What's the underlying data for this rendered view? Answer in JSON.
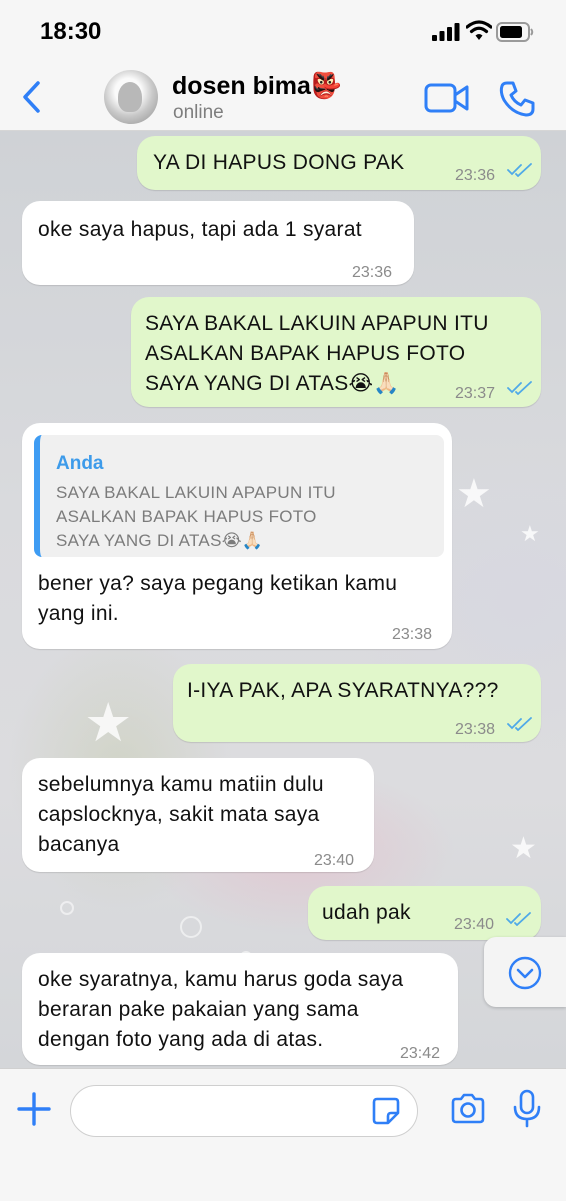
{
  "status_bar": {
    "time": "18:30"
  },
  "header": {
    "contact_name": "dosen bima👺",
    "status": "online"
  },
  "messages": [
    {
      "dir": "out",
      "text": "YA DI HAPUS DONG PAK",
      "time": "23:36"
    },
    {
      "dir": "in",
      "text": "oke saya hapus, tapi ada 1 syarat",
      "time": "23:36"
    },
    {
      "dir": "out",
      "text": "SAYA BAKAL LAKUIN APAPUN ITU\nASALKAN BAPAK HAPUS FOTO\nSAYA YANG DI ATAS😭🙏🏻",
      "time": "23:37"
    },
    {
      "dir": "in",
      "quote_author": "Anda",
      "quote_text": "SAYA BAKAL LAKUIN APAPUN ITU\nASALKAN BAPAK HAPUS FOTO\nSAYA YANG DI ATAS😭🙏🏻",
      "text": "bener ya? saya pegang ketikan kamu\nyang ini.",
      "time": "23:38"
    },
    {
      "dir": "out",
      "text": "I-IYA PAK, APA SYARATNYA???",
      "time": "23:38"
    },
    {
      "dir": "in",
      "text": "sebelumnya kamu matiin dulu\ncapslocknya, sakit mata saya\nbacanya",
      "time": "23:40"
    },
    {
      "dir": "out",
      "text": "udah pak",
      "time": "23:40"
    },
    {
      "dir": "in",
      "text": "oke syaratnya, kamu harus goda saya\nberaran pake pakaian yang sama\ndengan foto yang ada di atas.",
      "time": "23:42"
    }
  ],
  "colors": {
    "accent": "#2f7ff7",
    "outgoing_bubble": "#e1f7cb",
    "incoming_bubble": "#ffffff",
    "read_ticks": "#4fa9e8"
  },
  "icons": [
    "back-chevron-icon",
    "video-call-icon",
    "phone-icon",
    "plus-icon",
    "sticker-icon",
    "camera-icon",
    "mic-icon",
    "scroll-down-icon"
  ]
}
